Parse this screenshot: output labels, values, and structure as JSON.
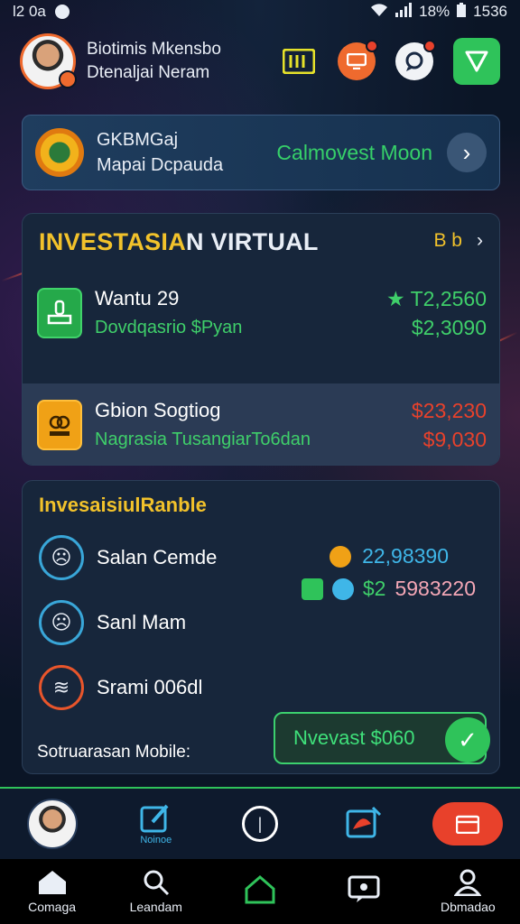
{
  "status_bar": {
    "time": "l2 0a",
    "battery": "18%",
    "clock_right": "1536"
  },
  "header": {
    "user_name": "Biotimis Mkensbo",
    "user_subtitle": "Dtenaljai Neram",
    "icons": [
      "calculator-icon",
      "monitor-icon",
      "chat-icon",
      "shield-icon"
    ]
  },
  "banner": {
    "title": "GKBMGaj",
    "subtitle": "Mapai Dcpauda",
    "cta": "Calmovest Moon"
  },
  "virtual_card": {
    "title_part1": "INVESTASIA",
    "title_part2": "N VIRTUAL",
    "link": "B b",
    "rows": [
      {
        "name": "Wantu 29",
        "sub": "Dovdqasrio $Pyan",
        "amount_top": "T2,2560",
        "amount_bottom": "$2,3090"
      },
      {
        "name": "Gbion Sogtiog",
        "sub": "Nagrasia TusangiarTo6dan",
        "amount_top": "$23,230",
        "amount_bottom": "$9,030"
      }
    ]
  },
  "list_card": {
    "title": "InvesaisiulRanble",
    "items": [
      {
        "name": "Salan Cemde"
      },
      {
        "name": "Sanl Mam"
      },
      {
        "name": "Srami 006dl"
      }
    ],
    "value_1": "22,98390",
    "value_2_prefix": "$2",
    "value_2_rest": "5983220",
    "footer_label": "Sotruarasan Mobile:",
    "invest_button": "Nvevast $060"
  },
  "dock": {
    "notes_label": "Noinoe"
  },
  "nav": [
    {
      "label": "Comaga"
    },
    {
      "label": "Leandam"
    },
    {
      "label": ""
    },
    {
      "label": ""
    },
    {
      "label": "Dbmadao"
    }
  ],
  "colors": {
    "accent_green": "#2fc35a",
    "accent_yellow": "#f2c22b",
    "accent_red": "#e8412b",
    "accent_blue": "#3fb6e8"
  }
}
